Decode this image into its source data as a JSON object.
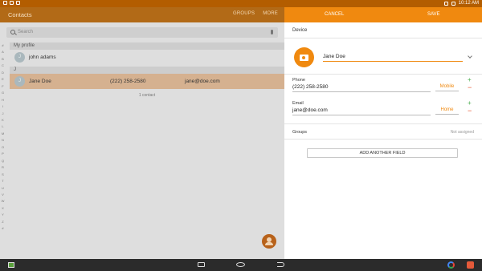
{
  "status_bar": {
    "time": "10:12 AM"
  },
  "contacts_app": {
    "title": "Contacts",
    "actions": [
      "GROUPS",
      "MORE"
    ],
    "search_placeholder": "Search",
    "alphabet": [
      "#",
      "A",
      "B",
      "C",
      "D",
      "E",
      "F",
      "G",
      "H",
      "I",
      "J",
      "K",
      "L",
      "M",
      "N",
      "O",
      "P",
      "Q",
      "R",
      "S",
      "T",
      "U",
      "V",
      "W",
      "X",
      "Y",
      "Z",
      "#"
    ],
    "my_profile_header": "My profile",
    "profile": {
      "initial": "J",
      "name": "john adams"
    },
    "section_j": "J",
    "contacts": [
      {
        "initial": "J",
        "name": "Jane Doe",
        "phone": "(222) 258-2580",
        "email": "jane@doe.com",
        "selected": true
      }
    ],
    "count_label": "1 contact"
  },
  "editor": {
    "cancel_label": "CANCEL",
    "save_label": "SAVE",
    "account": "Device",
    "name_value": "Jane Doe",
    "phone": {
      "label": "Phone",
      "value": "(222) 258-2580",
      "type": "Mobile"
    },
    "email": {
      "label": "Email",
      "value": "jane@doe.com",
      "type": "Home"
    },
    "groups": {
      "label": "Groups",
      "value": "Not assigned"
    },
    "add_field_label": "ADD ANOTHER FIELD",
    "plus_glyph": "+",
    "minus_glyph": "−"
  },
  "colors": {
    "accent": "#f0890f",
    "accent_dimmed": "#b26a17",
    "selected_row": "#d5b190",
    "add_green": "#4caf50",
    "remove_red": "#e6502a"
  },
  "icons": [
    "camera-icon",
    "search-icon",
    "mic-icon",
    "add-contact-icon",
    "chevron-down-icon",
    "recent-apps-icon",
    "home-icon",
    "back-icon",
    "google-icon"
  ]
}
